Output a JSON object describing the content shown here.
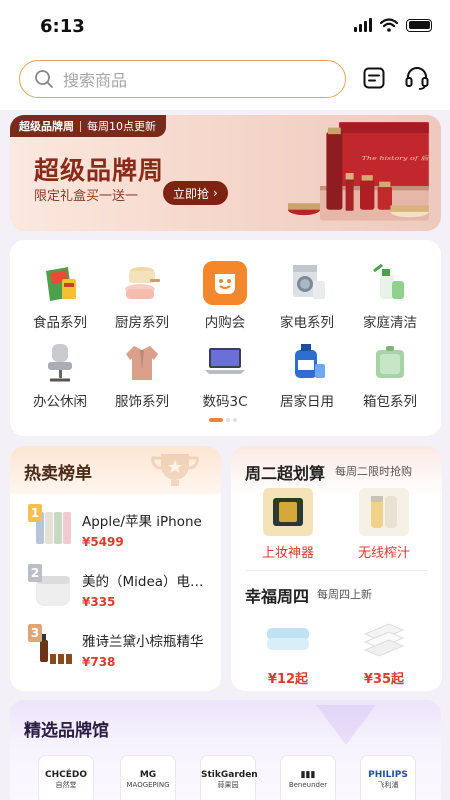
{
  "status": {
    "time": "6:13"
  },
  "search": {
    "placeholder": "搜索商品"
  },
  "banner": {
    "tag_title": "超级品牌周",
    "tag_sub": "每周10点更新",
    "title": "超级品牌周",
    "desc": "限定礼盒买一送一",
    "cta": "立即抢",
    "box_text": "The history of 后"
  },
  "categories": [
    {
      "label": "食品系列",
      "icon": "snack-food-icon"
    },
    {
      "label": "厨房系列",
      "icon": "cookware-icon"
    },
    {
      "label": "内购会",
      "icon": "app-logo-icon"
    },
    {
      "label": "家电系列",
      "icon": "washing-machine-icon"
    },
    {
      "label": "家庭清洁",
      "icon": "cleaning-icon"
    },
    {
      "label": "办公休闲",
      "icon": "office-chair-icon"
    },
    {
      "label": "服饰系列",
      "icon": "clothing-icon"
    },
    {
      "label": "数码3C",
      "icon": "laptop-icon"
    },
    {
      "label": "居家日用",
      "icon": "detergent-icon"
    },
    {
      "label": "箱包系列",
      "icon": "bag-icon"
    }
  ],
  "hot": {
    "title": "热卖榜单",
    "items": [
      {
        "rank": "1",
        "name": "Apple/苹果 iPhone",
        "price": "¥5499"
      },
      {
        "rank": "2",
        "name": "美的（Midea）电饭煲",
        "price": "¥335"
      },
      {
        "rank": "3",
        "name": "雅诗兰黛小棕瓶精华",
        "price": "¥738"
      }
    ]
  },
  "promo": {
    "title1": "周二超划算",
    "sub1": "每周二限时抢购",
    "items1": [
      {
        "label": "上妆神器"
      },
      {
        "label": "无线榨汁"
      }
    ],
    "title2": "幸福周四",
    "sub2": "每周四上新",
    "items2": [
      {
        "price": "¥12起"
      },
      {
        "price": "¥35起"
      }
    ]
  },
  "brands": {
    "title": "精选品牌馆",
    "logos": [
      {
        "a": "CHCÉDO",
        "b": "自然堂"
      },
      {
        "a": "MG",
        "b": "MAOGEPING"
      },
      {
        "a": "StikGarden",
        "b": "蒜果园"
      },
      {
        "a": "▮▮▮",
        "b": "Beneunder"
      },
      {
        "a": "PHILIPS",
        "b": "飞利浦"
      }
    ]
  },
  "colors": {
    "accent": "#e7a35c",
    "price": "#e0392f",
    "brand": "#7a2a18"
  }
}
